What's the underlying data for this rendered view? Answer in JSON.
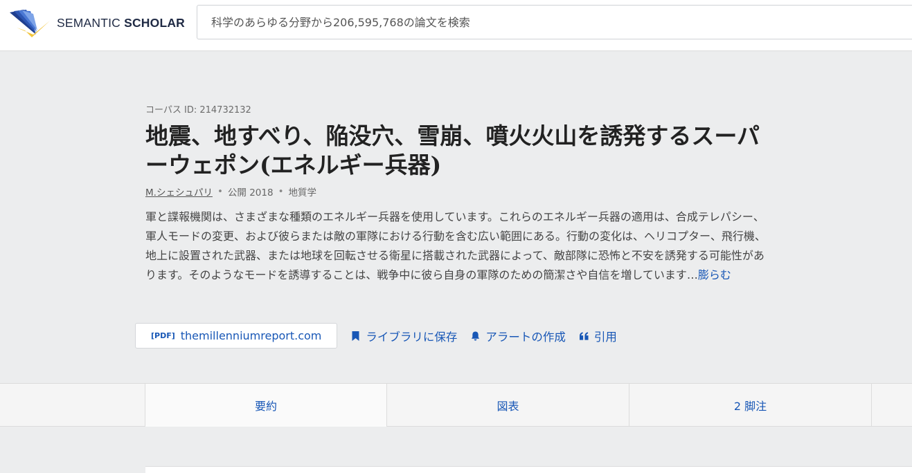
{
  "brand": {
    "name_light": "SEMANTIC",
    "name_bold": "SCHOLAR"
  },
  "search": {
    "placeholder": "科学のあらゆる分野から206,595,768の論文を検索"
  },
  "paper": {
    "corpus_id": "コーパス ID: 214732132",
    "title": "地震、地すべり、陥没穴、雪崩、噴火火山を誘発するスーパーウェポン(エネルギー兵器)",
    "author": "M.シェシュパリ",
    "published": "公開 2018",
    "field": "地質学",
    "abstract": "軍と諜報機関は、さまざまな種類のエネルギー兵器を使用しています。これらのエネルギー兵器の適用は、合成テレパシー、軍人モードの変更、および彼らまたは敵の軍隊における行動を含む広い範囲にある。行動の変化は、ヘリコプター、飛行機、地上に設置された武器、または地球を回転させる衛星に搭載された武器によって、敵部隊に恐怖と不安を誘発する可能性があります。そのようなモードを誘導することは、戦争中に彼ら自身の軍隊のための簡潔さや自信を増しています…",
    "expand_label": "膨らむ"
  },
  "actions": {
    "pdf_tag": "[PDF]",
    "pdf_source": "themillenniumreport.com",
    "save": "ライブラリに保存",
    "alert": "アラートの作成",
    "cite": "引用"
  },
  "tabs": [
    {
      "label": "要約"
    },
    {
      "label": "図表"
    },
    {
      "label": "2 脚注"
    }
  ],
  "colors": {
    "link": "#1857b6",
    "logo_blue": "#1f3f8f",
    "logo_gold": "#f2c53d"
  }
}
